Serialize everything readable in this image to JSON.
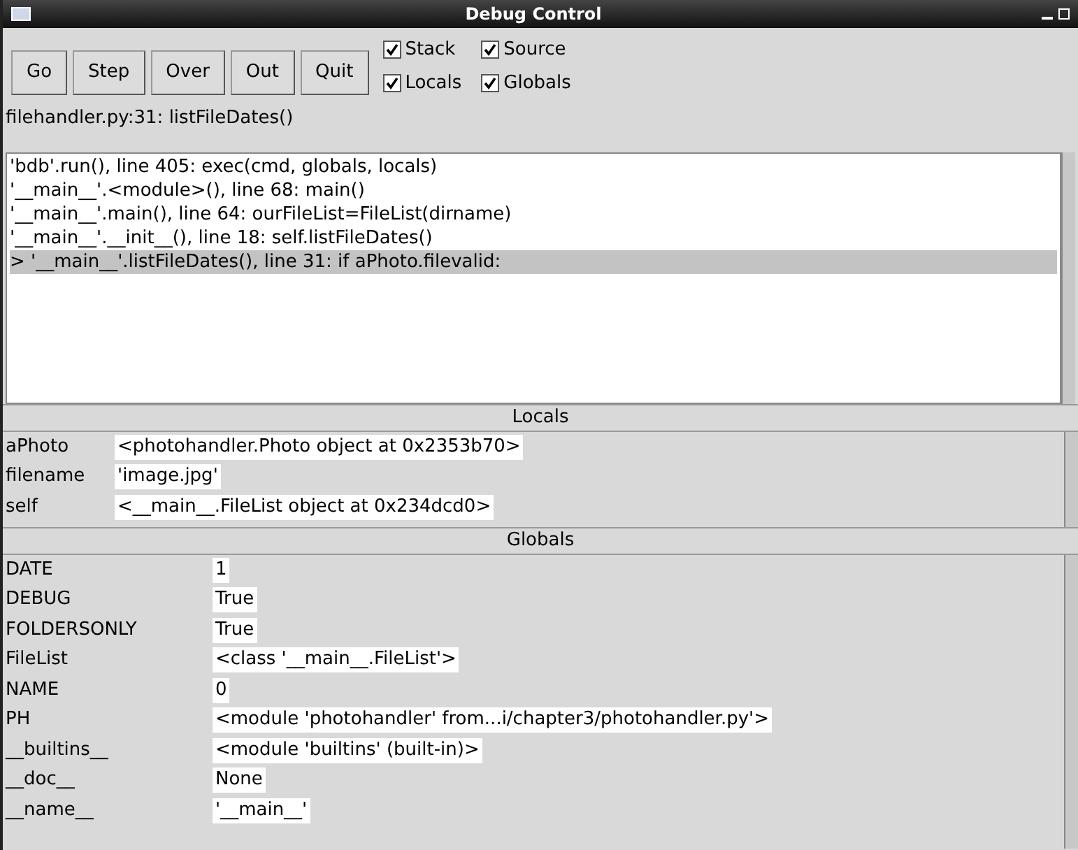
{
  "window": {
    "title": "Debug Control"
  },
  "buttons": [
    "Go",
    "Step",
    "Over",
    "Out",
    "Quit"
  ],
  "checkboxes": [
    {
      "label": "Stack",
      "checked": true
    },
    {
      "label": "Source",
      "checked": true
    },
    {
      "label": "Locals",
      "checked": true
    },
    {
      "label": "Globals",
      "checked": true
    }
  ],
  "status": "filehandler.py:31: listFileDates()",
  "stack": [
    {
      "text": "'bdb'.run(), line 405: exec(cmd, globals, locals)",
      "selected": false
    },
    {
      "text": "'__main__'.<module>(), line 68: main()",
      "selected": false
    },
    {
      "text": "'__main__'.main(), line 64: ourFileList=FileList(dirname)",
      "selected": false
    },
    {
      "text": "'__main__'.__init__(), line 18: self.listFileDates()",
      "selected": false
    },
    {
      "text": "> '__main__'.listFileDates(), line 31: if aPhoto.filevalid:",
      "selected": true
    }
  ],
  "locals": {
    "title": "Locals",
    "rows": [
      {
        "name": "aPhoto",
        "value": "<photohandler.Photo object at 0x2353b70>"
      },
      {
        "name": "filename",
        "value": "'image.jpg'"
      },
      {
        "name": "self",
        "value": "<__main__.FileList object at 0x234dcd0>"
      }
    ]
  },
  "globals": {
    "title": "Globals",
    "rows": [
      {
        "name": "DATE",
        "value": "1"
      },
      {
        "name": "DEBUG",
        "value": "True"
      },
      {
        "name": "FOLDERSONLY",
        "value": "True"
      },
      {
        "name": "FileList",
        "value": "<class '__main__.FileList'>"
      },
      {
        "name": "NAME",
        "value": "0"
      },
      {
        "name": "PH",
        "value": "<module 'photohandler' from...i/chapter3/photohandler.py'>"
      },
      {
        "name": "__builtins__",
        "value": "<module 'builtins' (built-in)>"
      },
      {
        "name": "__doc__",
        "value": "None"
      },
      {
        "name": "__name__",
        "value": "'__main__'"
      }
    ]
  }
}
